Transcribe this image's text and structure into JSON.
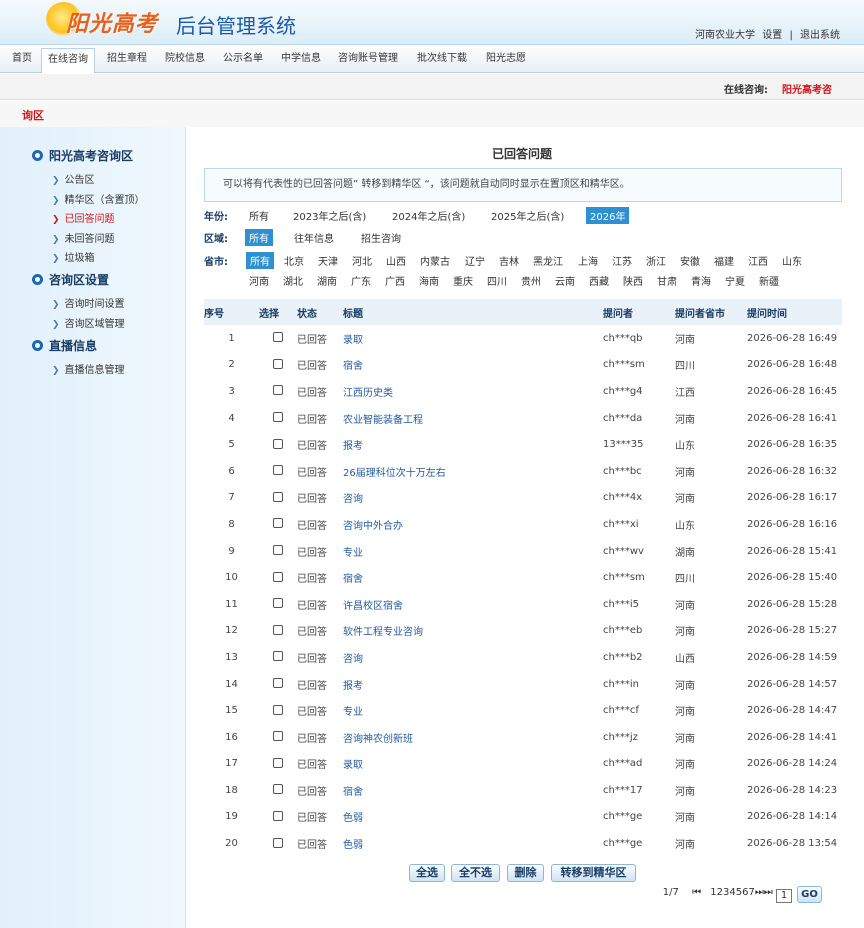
{
  "header": {
    "logo_text": "阳光高考",
    "title": "后台管理系统",
    "user": "河南农业大学",
    "settings": "设置",
    "separator": "|",
    "logout": "退出系统"
  },
  "nav": [
    {
      "label": "首页",
      "active": false
    },
    {
      "label": "在线咨询",
      "active": true
    },
    {
      "label": "招生章程",
      "active": false
    },
    {
      "label": "院校信息",
      "active": false
    },
    {
      "label": "公示名单",
      "active": false
    },
    {
      "label": "中学信息",
      "active": false
    },
    {
      "label": "咨询账号管理",
      "active": false
    },
    {
      "label": "批次线下载",
      "active": false
    },
    {
      "label": "阳光志愿",
      "active": false
    }
  ],
  "status": {
    "label": "在线咨询:",
    "value": "阳光高考咨"
  },
  "zone": "询区",
  "sidebar": {
    "sections": [
      {
        "title": "阳光高考咨询区",
        "items": [
          "公告区",
          "精华区（含置顶）",
          "已回答问题",
          "未回答问题",
          "垃圾箱"
        ]
      },
      {
        "title": "咨询区设置",
        "items": [
          "咨询时间设置",
          "咨询区域管理"
        ]
      },
      {
        "title": "直播信息",
        "items": [
          "直播信息管理"
        ]
      }
    ],
    "active_item": "已回答问题"
  },
  "main": {
    "title": "已回答问题",
    "notice": "可以将有代表性的已回答问题” 转移到精华区 “，该问题就自动同时显示在置顶区和精华区。",
    "filters": {
      "year_label": "年份:",
      "years": [
        "所有",
        "2023年之后(含)",
        "2024年之后(含)",
        "2025年之后(含)",
        "2026年"
      ],
      "region_label": "区域:",
      "regions": [
        "所有",
        "往年信息",
        "招生咨询"
      ],
      "province_label": "省市:",
      "provinces_row1": [
        "所有",
        "北京",
        "天津",
        "河北",
        "山西",
        "内蒙古",
        "辽宁",
        "吉林",
        "黑龙江",
        "上海",
        "江苏",
        "浙江",
        "安徽",
        "福建",
        "江西",
        "山东"
      ],
      "provinces_row2": [
        "河南",
        "湖北",
        "湖南",
        "广东",
        "广西",
        "海南",
        "重庆",
        "四川",
        "贵州",
        "云南",
        "西藏",
        "陕西",
        "甘肃",
        "青海",
        "宁夏",
        "新疆"
      ]
    },
    "table": {
      "headers": [
        "序号",
        "选择",
        "状态",
        "标题",
        "提问者",
        "提问者省市",
        "提问时间"
      ],
      "rows": [
        [
          "1",
          "已回答",
          "录取",
          "ch***qb",
          "河南",
          "2026-06-28 16:49"
        ],
        [
          "2",
          "已回答",
          "宿舍",
          "ch***sm",
          "四川",
          "2026-06-28 16:48"
        ],
        [
          "3",
          "已回答",
          "江西历史类",
          "ch***g4",
          "江西",
          "2026-06-28 16:45"
        ],
        [
          "4",
          "已回答",
          "农业智能装备工程",
          "ch***da",
          "河南",
          "2026-06-28 16:41"
        ],
        [
          "5",
          "已回答",
          "报考",
          "13***35",
          "山东",
          "2026-06-28 16:35"
        ],
        [
          "6",
          "已回答",
          "26届理科位次十万左右",
          "ch***bc",
          "河南",
          "2026-06-28 16:32"
        ],
        [
          "7",
          "已回答",
          "咨询",
          "ch***4x",
          "河南",
          "2026-06-28 16:17"
        ],
        [
          "8",
          "已回答",
          "咨询中外合办",
          "ch***xi",
          "山东",
          "2026-06-28 16:16"
        ],
        [
          "9",
          "已回答",
          "专业",
          "ch***wv",
          "湖南",
          "2026-06-28 15:41"
        ],
        [
          "10",
          "已回答",
          "宿舍",
          "ch***sm",
          "四川",
          "2026-06-28 15:40"
        ],
        [
          "11",
          "已回答",
          "许昌校区宿舍",
          "ch***i5",
          "河南",
          "2026-06-28 15:28"
        ],
        [
          "12",
          "已回答",
          "软件工程专业咨询",
          "ch***eb",
          "河南",
          "2026-06-28 15:27"
        ],
        [
          "13",
          "已回答",
          "咨询",
          "ch***b2",
          "山西",
          "2026-06-28 14:59"
        ],
        [
          "14",
          "已回答",
          "报考",
          "ch***in",
          "河南",
          "2026-06-28 14:57"
        ],
        [
          "15",
          "已回答",
          "专业",
          "ch***cf",
          "河南",
          "2026-06-28 14:47"
        ],
        [
          "16",
          "已回答",
          "咨询神农创新班",
          "ch***jz",
          "河南",
          "2026-06-28 14:41"
        ],
        [
          "17",
          "已回答",
          "录取",
          "ch***ad",
          "河南",
          "2026-06-28 14:24"
        ],
        [
          "18",
          "已回答",
          "宿舍",
          "ch***17",
          "河南",
          "2026-06-28 14:23"
        ],
        [
          "19",
          "已回答",
          "色弱",
          "ch***ge",
          "河南",
          "2026-06-28 14:14"
        ],
        [
          "20",
          "已回答",
          "色弱",
          "ch***ge",
          "河南",
          "2026-06-28 13:54"
        ]
      ]
    },
    "buttons": {
      "select_all": "全选",
      "select_none": "全不选",
      "delete": "删除",
      "move": "转移到精华区"
    },
    "pager": {
      "page_info": "1/7",
      "first": "⏮",
      "pages": "1234567",
      "next_last": "⏭⏭",
      "input_value": "1",
      "go": "GO"
    }
  }
}
